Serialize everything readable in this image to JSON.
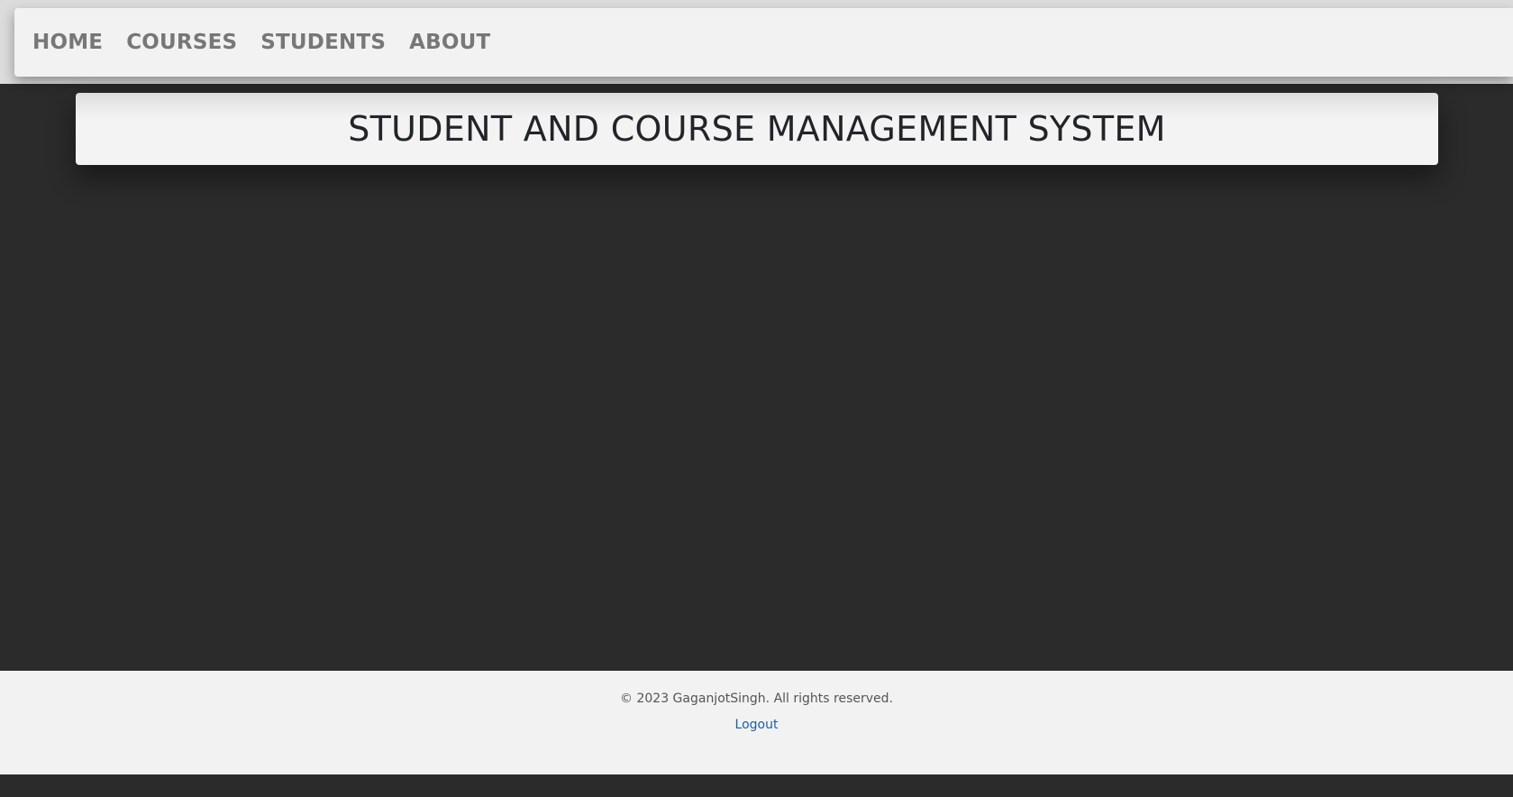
{
  "nav": {
    "items": [
      {
        "label": "HOME"
      },
      {
        "label": "COURSES"
      },
      {
        "label": "STUDENTS"
      },
      {
        "label": "ABOUT"
      }
    ]
  },
  "main": {
    "title": "STUDENT AND COURSE MANAGEMENT SYSTEM"
  },
  "footer": {
    "copyright": "© 2023 GaganjotSingh. All rights reserved.",
    "logout_label": "Logout"
  },
  "colors": {
    "background": "#2b2b2b",
    "navbar": "#f2f2f2",
    "nav_text": "#777777",
    "title_text": "#212529",
    "link": "#1a5fa8"
  }
}
